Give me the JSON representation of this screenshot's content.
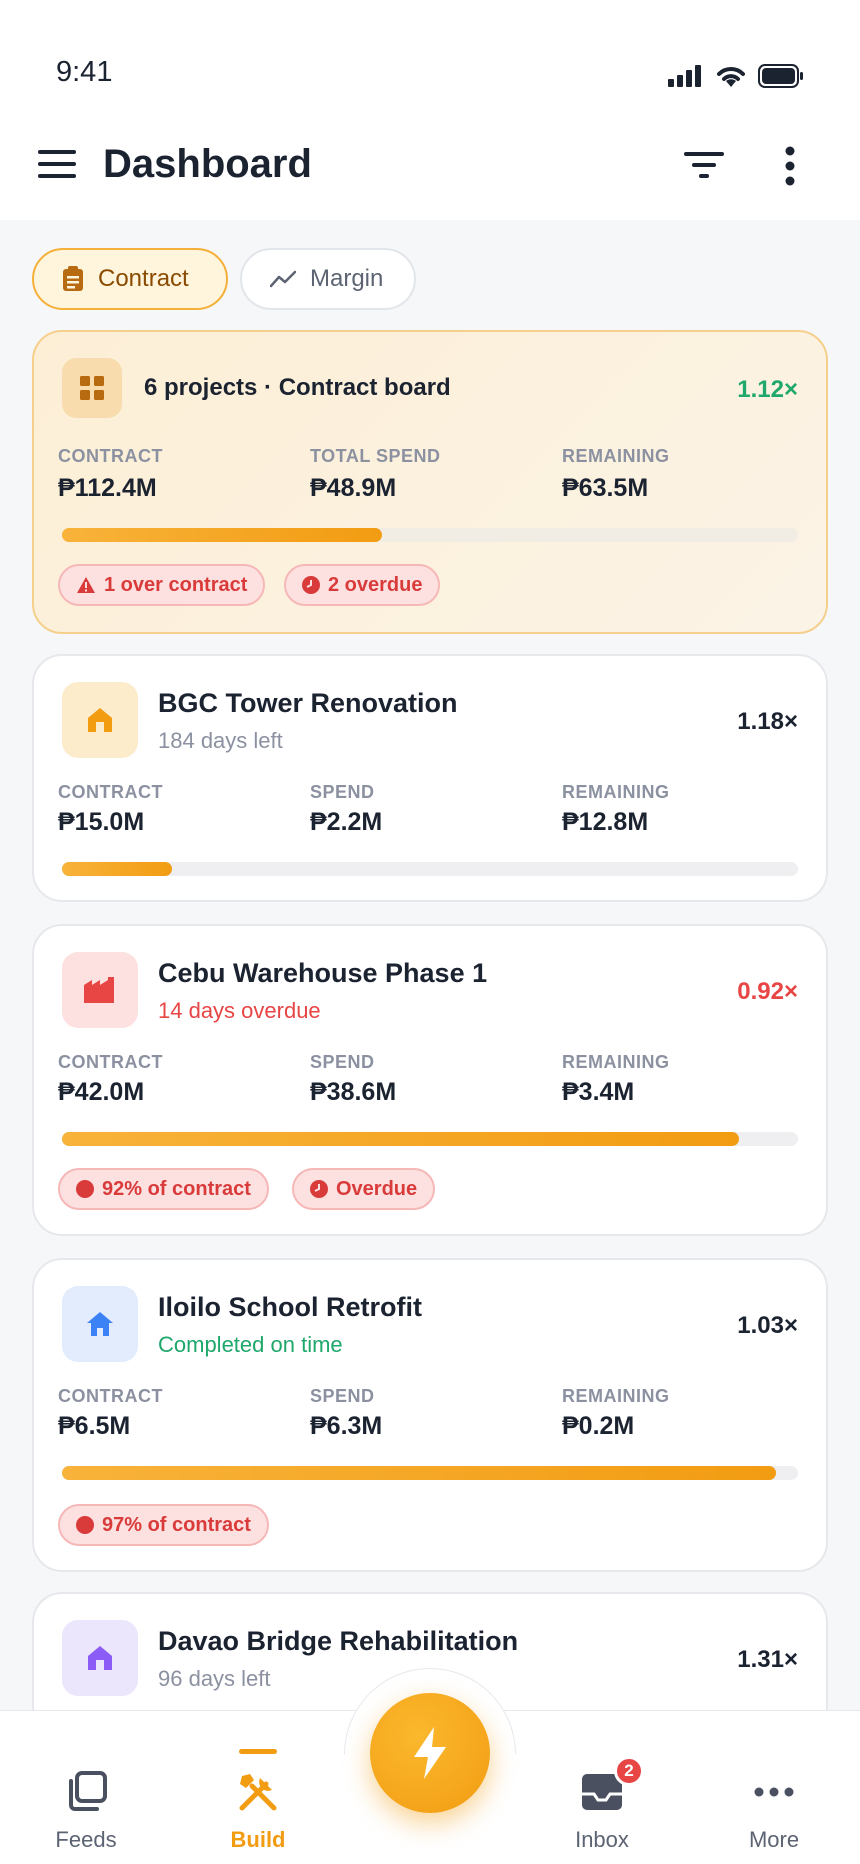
{
  "status_bar": {
    "time": "9:41"
  },
  "header": {
    "title": "Dashboard"
  },
  "view_toggle": {
    "contract_label": "Contract",
    "margin_label": "Margin"
  },
  "summary": {
    "title": "6 projects · Contract board",
    "multiplier": "1.12×",
    "contract_label": "CONTRACT",
    "contract_value": "₱112.4M",
    "spend_label": "TOTAL SPEND",
    "spend_value": "₱48.9M",
    "remaining_label": "REMAINING",
    "remaining_value": "₱63.5M",
    "progress": 0.435,
    "badges": [
      "1 over contract",
      "2 overdue"
    ]
  },
  "projects": [
    {
      "name": "BGC Tower Renovation",
      "status": "184 days left",
      "multiplier": "1.18×",
      "contract_label": "CONTRACT",
      "contract": "₱15.0M",
      "spend_label": "SPEND",
      "spend": "₱2.2M",
      "remaining_label": "REMAINING",
      "remaining": "₱12.8M",
      "progress": 0.15,
      "badges": [],
      "icon": "house-icon",
      "tile_color": "#fdeccc",
      "icon_color": "#f29c12"
    },
    {
      "name": "Cebu Warehouse Phase 1",
      "status": "14 days overdue",
      "multiplier": "0.92×",
      "contract_label": "CONTRACT",
      "contract": "₱42.0M",
      "spend_label": "SPEND",
      "spend": "₱38.6M",
      "remaining_label": "REMAINING",
      "remaining": "₱3.4M",
      "progress": 0.92,
      "badges": [
        "92% of contract",
        "Overdue"
      ],
      "icon": "factory-icon",
      "tile_color": "#fde1e1",
      "icon_color": "#e84545"
    },
    {
      "name": "Iloilo School Retrofit",
      "status": "Completed on time",
      "multiplier": "1.03×",
      "contract_label": "CONTRACT",
      "contract": "₱6.5M",
      "spend_label": "SPEND",
      "spend": "₱6.3M",
      "remaining_label": "REMAINING",
      "remaining": "₱0.2M",
      "progress": 0.97,
      "badges": [
        "97% of contract"
      ],
      "icon": "home-icon",
      "tile_color": "#e3ecfd",
      "icon_color": "#3b82f6"
    },
    {
      "name": "Davao Bridge Rehabilitation",
      "status": "96 days left",
      "multiplier": "1.31×",
      "icon": "house-icon",
      "tile_color": "#ece6fd",
      "icon_color": "#8b5cf6"
    }
  ],
  "colors": {
    "accent": "#f29c12",
    "danger": "#e84545",
    "success": "#1fa86b",
    "text": "#1b2230"
  },
  "nav": {
    "feeds": "Feeds",
    "build": "Build",
    "inbox": "Inbox",
    "more": "More",
    "inbox_badge": "2"
  }
}
